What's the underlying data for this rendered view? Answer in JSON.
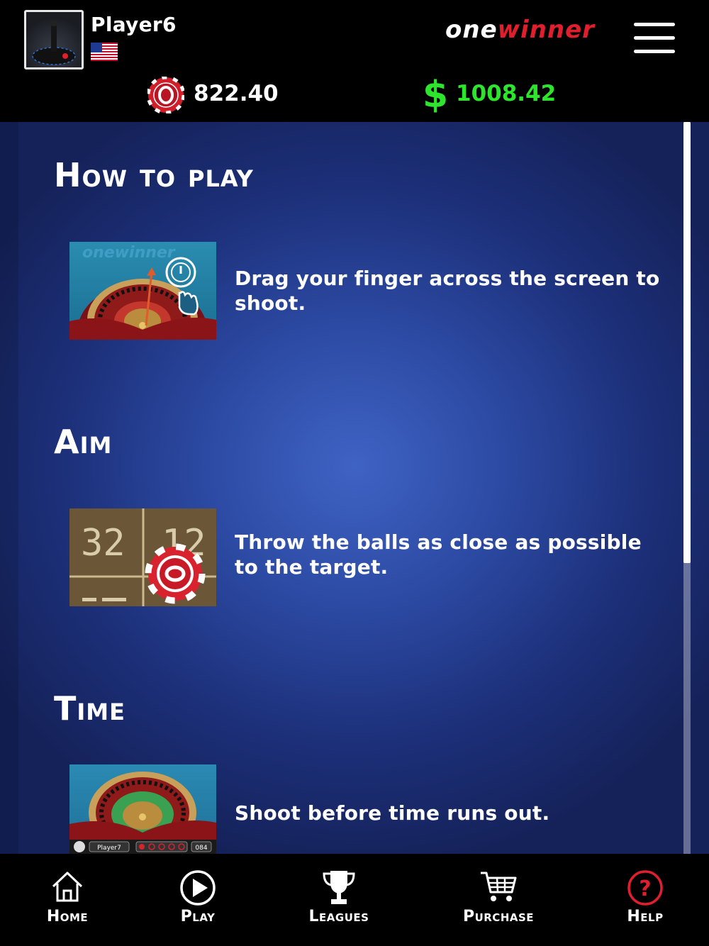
{
  "header": {
    "player_name": "Player6",
    "flag": "us-flag-icon",
    "logo_one": "one",
    "logo_winner": "winner",
    "chip_balance": "822.40",
    "cash_symbol": "$",
    "cash_balance": "1008.42"
  },
  "sections": [
    {
      "title": "How to play",
      "thumb_watermark": "onewinner",
      "description": "Drag your finger across the screen to shoot."
    },
    {
      "title": "Aim",
      "thumb_numbers": [
        "32",
        "12"
      ],
      "description": "Throw the balls as close as possible to the target."
    },
    {
      "title": "Time",
      "thumb_player": "Player7",
      "thumb_timer": "084",
      "description": "Shoot before time runs out."
    }
  ],
  "nav": {
    "home": "Home",
    "play": "Play",
    "leagues": "Leagues",
    "purchase": "Purchase",
    "help": "Help"
  },
  "colors": {
    "brand_red": "#e01e2d",
    "cash_green": "#2ee52e",
    "content_blue": "#2c4aa3"
  }
}
